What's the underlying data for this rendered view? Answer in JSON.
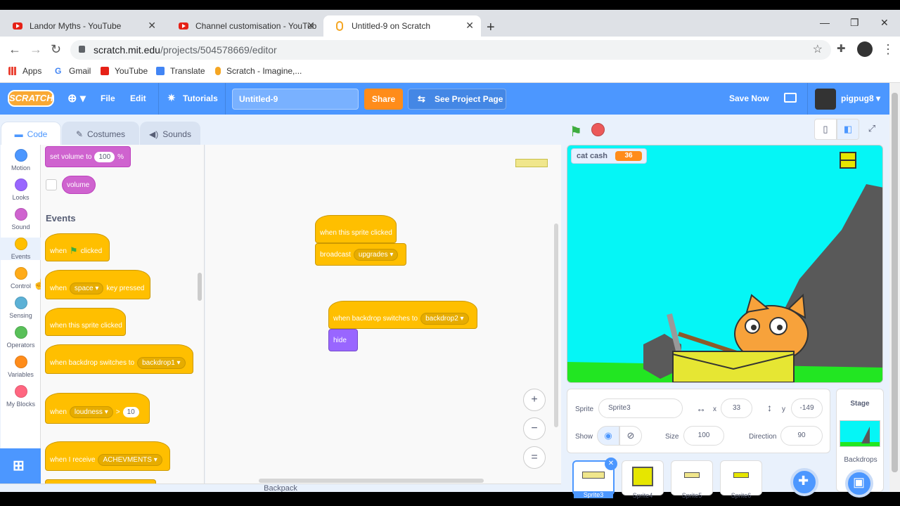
{
  "browser": {
    "tabs": [
      {
        "title": "Landor Myths - YouTube"
      },
      {
        "title": "Channel customisation - YouTub"
      },
      {
        "title": "Untitled-9 on Scratch"
      }
    ],
    "url_host": "scratch.mit.edu",
    "url_path": "/projects/504578669/editor",
    "bookmarks": [
      "Apps",
      "Gmail",
      "YouTube",
      "Translate",
      "Scratch - Imagine,..."
    ]
  },
  "menubar": {
    "logo": "SCRATCH",
    "file": "File",
    "edit": "Edit",
    "tutorials": "Tutorials",
    "project_title": "Untitled-9",
    "share": "Share",
    "see_project": "See Project Page",
    "save_now": "Save Now",
    "username": "pigpug8"
  },
  "editor_tabs": [
    "Code",
    "Costumes",
    "Sounds"
  ],
  "categories": [
    {
      "label": "Motion",
      "color": "#4c97ff"
    },
    {
      "label": "Looks",
      "color": "#9966ff"
    },
    {
      "label": "Sound",
      "color": "#cf63cf"
    },
    {
      "label": "Events",
      "color": "#ffbf00"
    },
    {
      "label": "Control",
      "color": "#ffab19"
    },
    {
      "label": "Sensing",
      "color": "#5cb1d6"
    },
    {
      "label": "Operators",
      "color": "#59c059"
    },
    {
      "label": "Variables",
      "color": "#ff8c1a"
    },
    {
      "label": "My Blocks",
      "color": "#ff6680"
    }
  ],
  "flyout": {
    "set_volume": "set volume to",
    "set_volume_val": "100",
    "set_volume_unit": "%",
    "volume": "volume",
    "events_header": "Events",
    "when": "when",
    "clicked": "clicked",
    "key_option": "space",
    "key_pressed": "key pressed",
    "sprite_clicked": "when this sprite clicked",
    "backdrop_switches": "when backdrop switches to",
    "backdrop_option": "backdrop1",
    "loudness_option": "loudness",
    "gt": ">",
    "loudness_val": "10",
    "receive": "when I receive",
    "receive_option": "ACHEVMENTS"
  },
  "scripts": {
    "s1_hat": "when this sprite clicked",
    "s1_broadcast": "broadcast",
    "s1_msg": "upgrades",
    "s2_hat": "when backdrop switches to",
    "s2_backdrop": "backdrop2",
    "s2_hide": "hide"
  },
  "zoom": {
    "in": "+",
    "out": "−",
    "reset": "="
  },
  "stage": {
    "monitor_label": "cat cash",
    "monitor_value": "36"
  },
  "sprite_info": {
    "sprite_label": "Sprite",
    "sprite_name": "Sprite3",
    "x_label": "x",
    "x": "33",
    "y_label": "y",
    "y": "-149",
    "show_label": "Show",
    "size_label": "Size",
    "size": "100",
    "direction_label": "Direction",
    "direction": "90"
  },
  "sprites": [
    "Sprite3",
    "Sprite4",
    "Sprite5",
    "Sprite6"
  ],
  "stage_panel": {
    "title": "Stage",
    "backdrops": "Backdrops"
  },
  "backpack": "Backpack"
}
